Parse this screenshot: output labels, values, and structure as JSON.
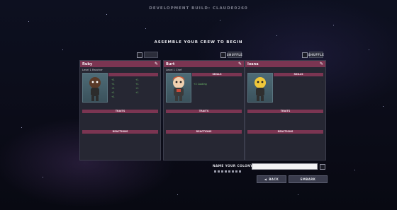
{
  "dev_build": "DEVELOPMENT BUILD: CLAUDE0260",
  "heading": "ASSEMBLE YOUR CREW TO BEGIN",
  "top_buttons": {
    "card1": "",
    "card2": "SHUFFLE",
    "card3": "SHUFFLE"
  },
  "cards": [
    {
      "name": "Ruby",
      "level": "Level 1 Rancher",
      "skills_header": "",
      "attributes_left": [
        "+1",
        "+1",
        "+1",
        "+1",
        "+1"
      ],
      "attributes_right": [
        "+1",
        "+1",
        "+1",
        "+1"
      ],
      "traits_header": "TRAITS",
      "traits_left": "",
      "traits_right": "",
      "reactions_header": "REACTIONS",
      "reaction_left": "",
      "reaction_right": "",
      "description": ""
    },
    {
      "name": "Burt",
      "level": "Level 1 Chef",
      "skills_header": "SKILLS",
      "attributes_left": [
        "",
        "+2 Cooking",
        "",
        "",
        ""
      ],
      "attributes_right": [
        "",
        "",
        "",
        ""
      ],
      "traits_header": "TRAITS",
      "traits_left": "",
      "traits_right": "",
      "reactions_header": "REACTIONS",
      "reaction_left": "",
      "reaction_right": "",
      "description": ""
    },
    {
      "name": "Ioana",
      "level": "",
      "skills_header": "SKILLS",
      "attributes_left": [
        "",
        "",
        "",
        ""
      ],
      "attributes_right": [
        "",
        "",
        "",
        ""
      ],
      "traits_header": "TRAITS",
      "traits_left": "",
      "traits_right": "",
      "reactions_header": "REACTIONS",
      "reaction_left": "",
      "reaction_right": "",
      "description": ""
    }
  ],
  "colony": {
    "label": "NAME YOUR COLONY",
    "value": ""
  },
  "buttons": {
    "back": "BACK",
    "embark": "EMBARK"
  },
  "colors": {
    "accent": "#7b3552",
    "card_bg": "#262733",
    "attribute_green": "#6fbf6a",
    "trait_red": "#c9546f"
  },
  "icons": {
    "edit": "pencil-icon",
    "shuffle": "shuffle-icon",
    "back": "back-arrow-icon"
  }
}
